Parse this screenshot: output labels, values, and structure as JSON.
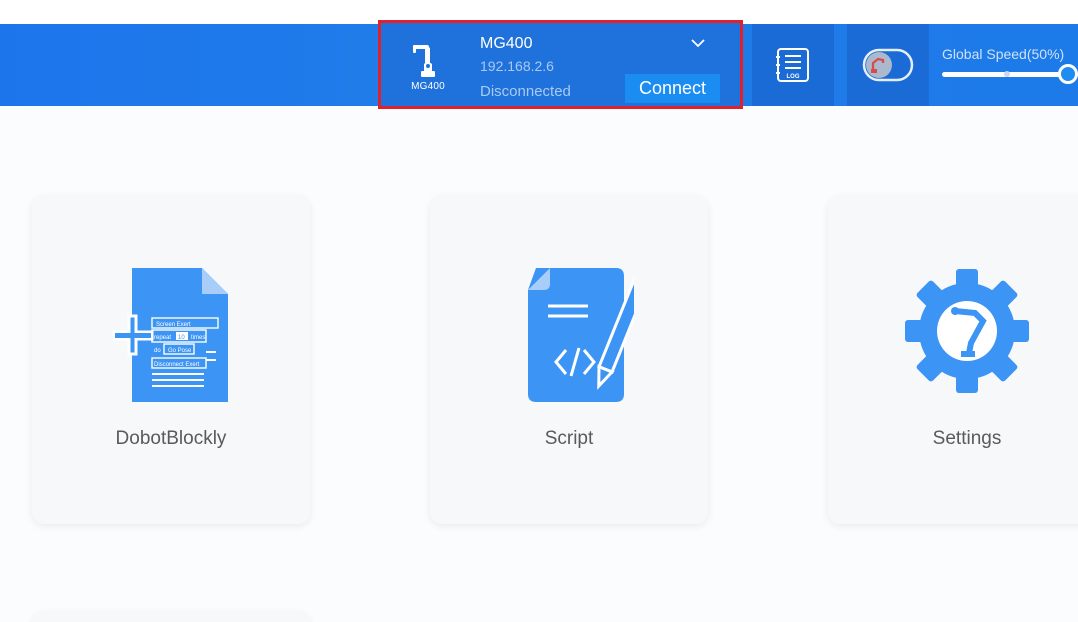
{
  "device": {
    "icon_label": "MG400",
    "name": "MG400",
    "ip": "192.168.2.6",
    "status": "Disconnected",
    "connect_label": "Connect",
    "dropdown_icon": "chevron-down-icon"
  },
  "toolbar": {
    "log_icon_text": "LOG",
    "speed_label": "Global Speed(50%)",
    "speed_value_percent": 50
  },
  "cards": [
    {
      "label": "DobotBlockly",
      "icon": "blockly-document-icon"
    },
    {
      "label": "Script",
      "icon": "script-document-icon"
    },
    {
      "label": "Settings",
      "icon": "settings-gear-icon"
    }
  ],
  "blockly_icon_text": {
    "line1": "Screen Exert",
    "line2": "repeat",
    "line3": "10",
    "line4": "times",
    "line5": "do",
    "line6": "Go Pose",
    "line7": "Disconnect Exert"
  },
  "colors": {
    "topbar": "#1d75ec",
    "highlight_border": "#e0202a",
    "connect_button": "#1b8cf2",
    "icon_blue": "#3c94f5",
    "background": "#fbfcfd"
  }
}
